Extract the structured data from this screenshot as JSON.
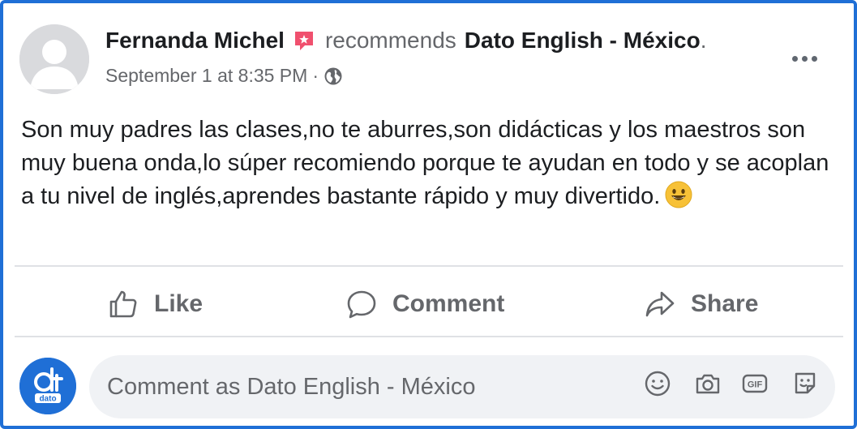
{
  "post": {
    "author": "Fernanda Michel",
    "action_text": "recommends",
    "page_name": "Dato English - México",
    "period": ".",
    "timestamp": "September 1 at 8:35 PM",
    "separator": "·",
    "privacy_icon": "globe-icon",
    "recommendation_badge_color": "#f0506e",
    "body": "Son muy padres las clases,no te aburres,son didácticas y los maestros son muy buena onda,lo súper recomiendo porque te ayudan en todo y se acoplan a tu nivel de inglés,aprendes bastante rápido y muy divertido.",
    "emoji": "grinning-face"
  },
  "actions": {
    "like_label": "Like",
    "comment_label": "Comment",
    "share_label": "Share"
  },
  "composer": {
    "placeholder": "Comment as Dato English - México",
    "avatar_logo_text": "dato",
    "avatar_color": "#1f6fd6",
    "icons": [
      "emoji-icon",
      "camera-icon",
      "gif-icon",
      "sticker-icon"
    ]
  },
  "colors": {
    "frame_border": "#1f6fd6",
    "text_primary": "#1c1e21",
    "text_secondary": "#65676b",
    "composer_bg": "#f0f2f5"
  }
}
